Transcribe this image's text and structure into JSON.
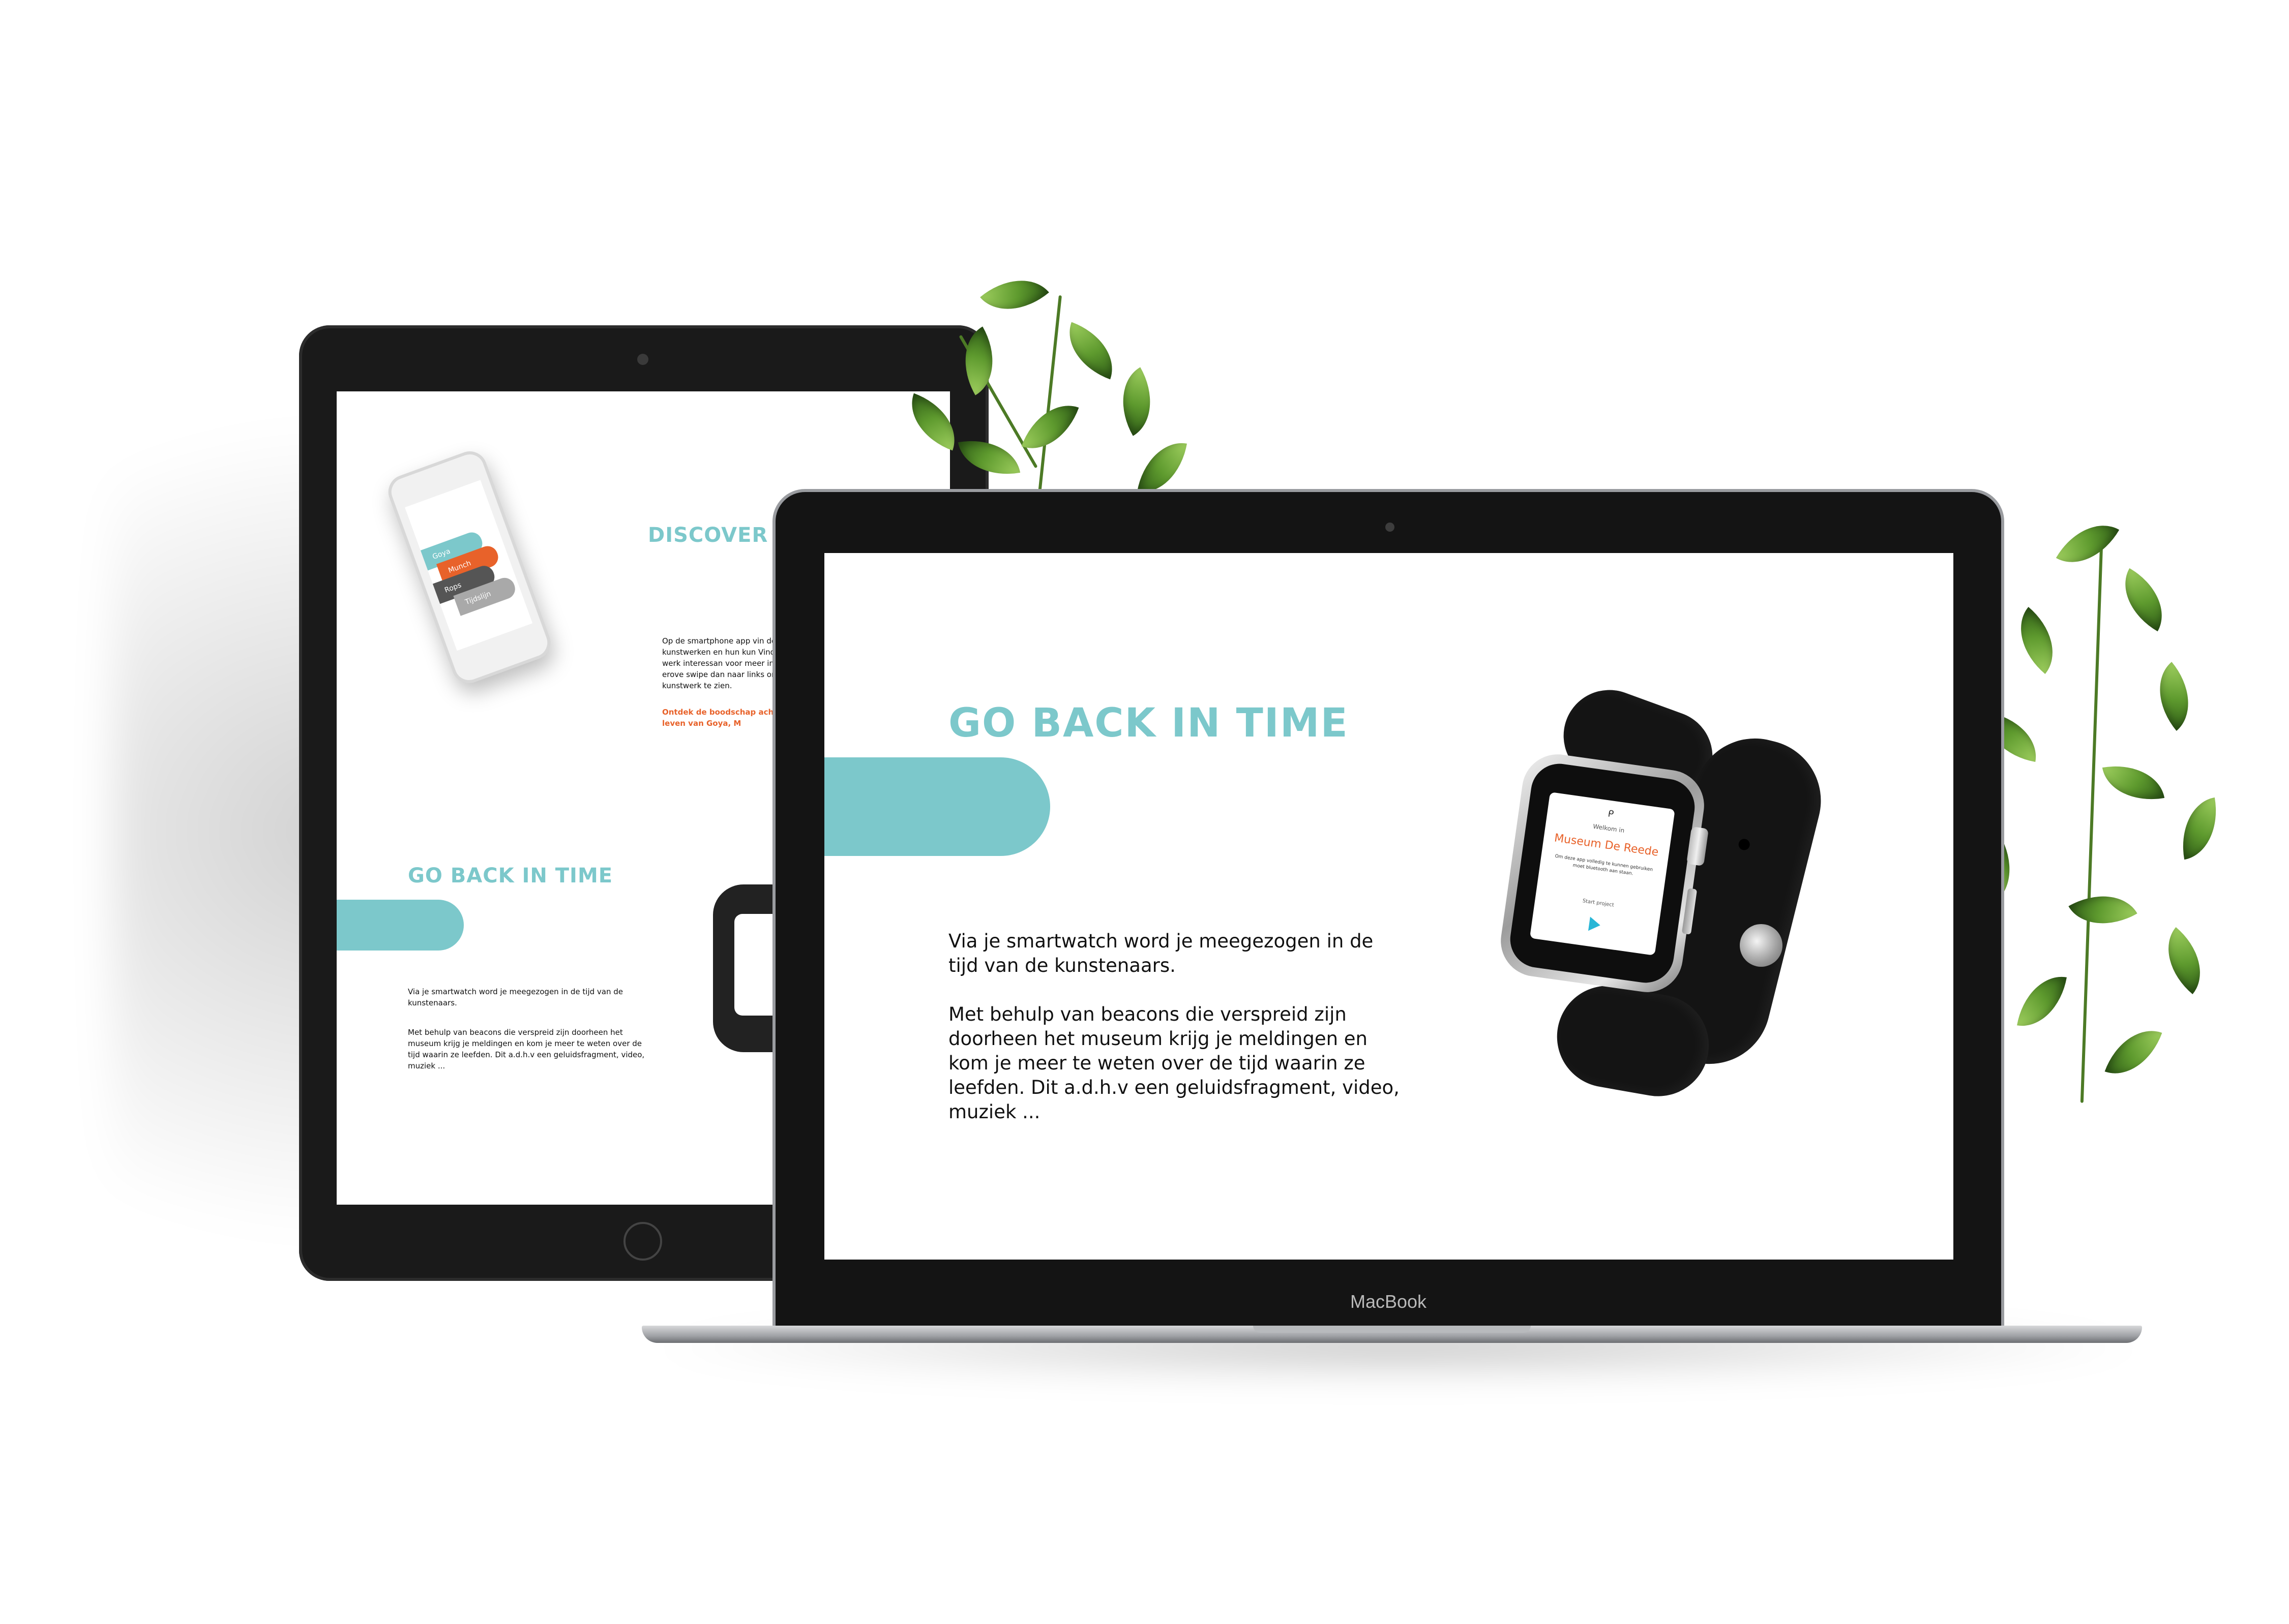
{
  "tablet": {
    "phone_cards": [
      "Goya",
      "Munch",
      "Rops",
      "Tijdslijn"
    ],
    "discover_heading": "DISCOVER THE",
    "discover_text": "Op de smartphone app vin de kunstwerken en hun kun Vind je het werk interessan voor meer informatie erove swipe dan naar links om ee kunstwerk te zien.",
    "discover_highlight": "Ontdek de boodschap ach over het leven van Goya, M",
    "section_title": "GO BACK IN TIME",
    "paragraph_1": "Via je smartwatch word je meegezogen in de tijd van de kunstenaars.",
    "paragraph_2": "Met behulp van beacons die verspreid zijn doorheen het museum krijg je meldingen en kom je meer te weten over de tijd waarin ze leefden. Dit a.d.h.v een geluidsfragment, video, muziek ..."
  },
  "laptop": {
    "brand": "MacBook",
    "title": "GO BACK IN TIME",
    "paragraph_1": "Via je smartwatch word je meegezogen in de tijd van de kunstenaars.",
    "paragraph_2": "Met behulp van beacons die verspreid zijn doorheen het museum krijg je meldingen en kom je meer te weten over de tijd waarin ze leefden. Dit a.d.h.v een geluidsfragment, video, muziek ..."
  },
  "watch": {
    "logo": "ᑭ",
    "welcome": "Welkom in",
    "museum_name": "Museum De Reede",
    "description": "Om deze app volledig te kunnen gebruiken moet bluetooth aan staan.",
    "start_label": "Start project",
    "icons": {
      "play": "play-icon"
    }
  },
  "colors": {
    "accent_teal": "#7cc8cb",
    "accent_orange": "#e8622a",
    "goya": "#7cc8cb",
    "munch": "#e8622a",
    "rops": "#555555",
    "tijdslijn": "#a9a9a9"
  }
}
